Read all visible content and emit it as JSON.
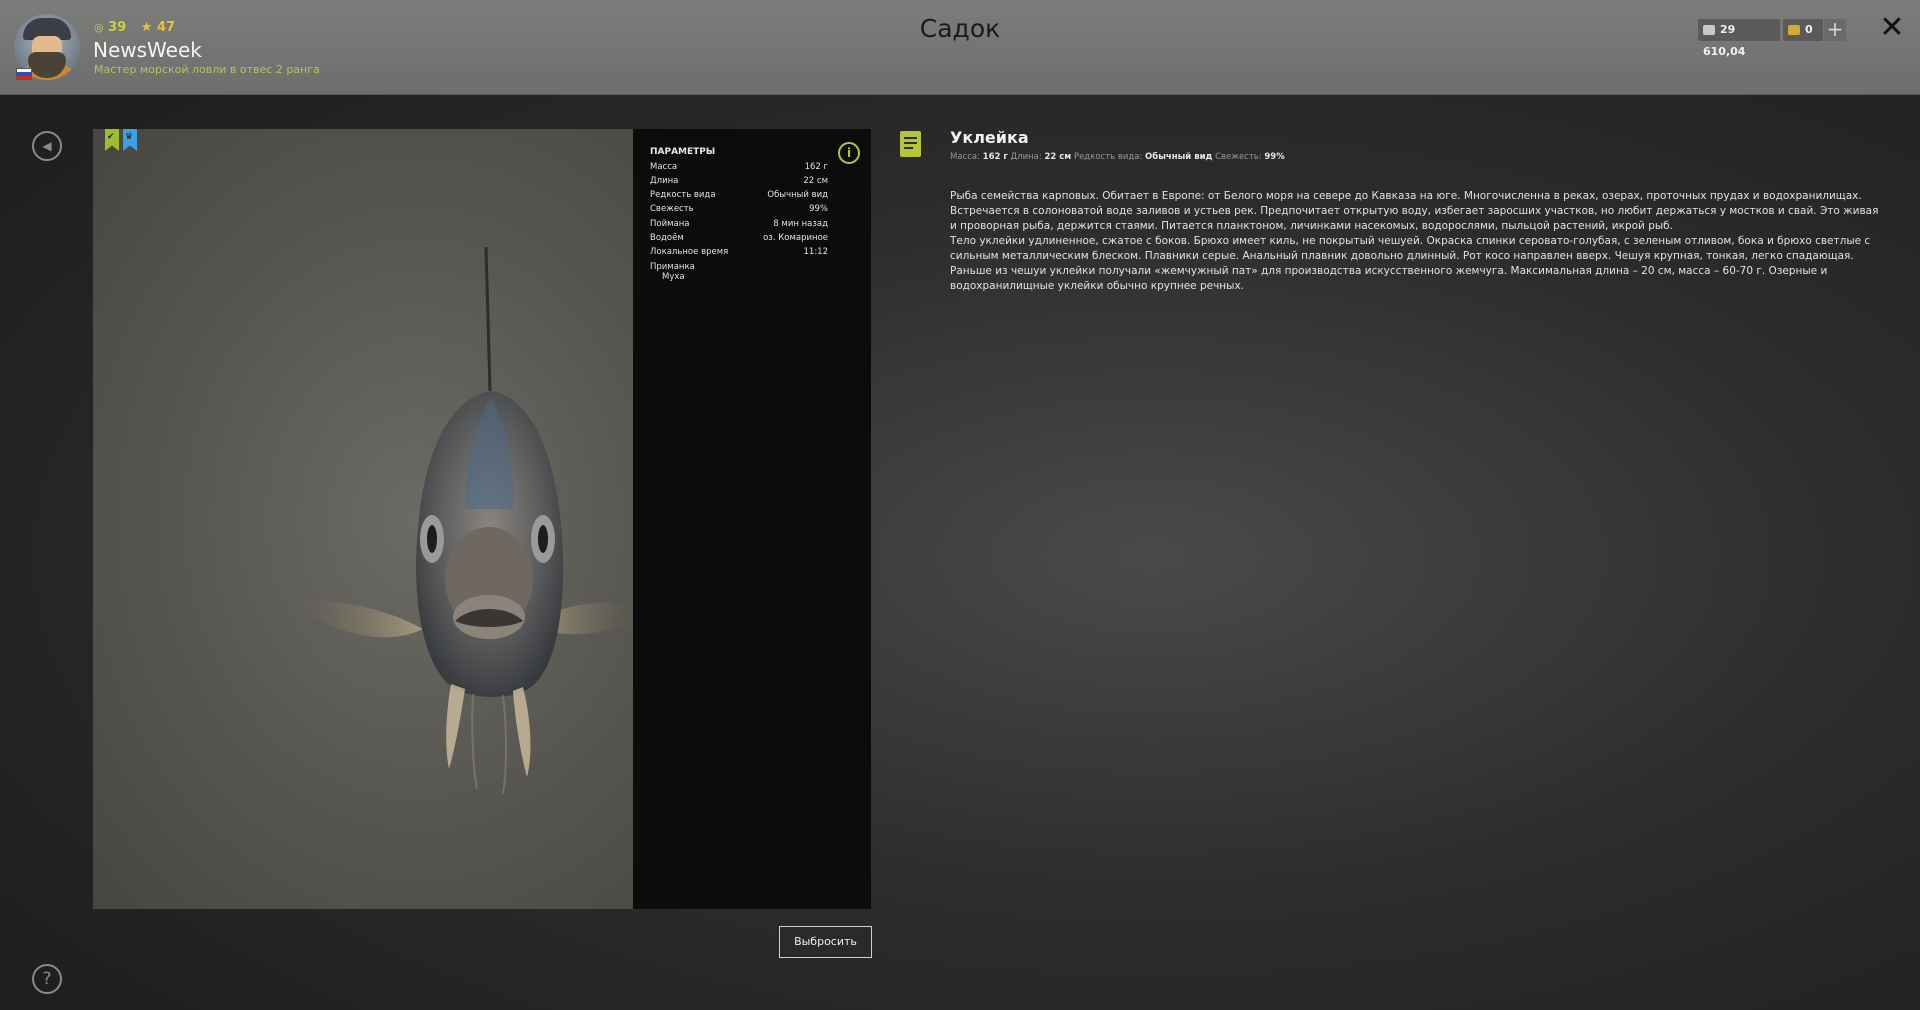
{
  "header": {
    "title": "Садок",
    "player": {
      "name": "NewsWeek",
      "level": "39",
      "stars": "47",
      "rank": "Мастер морской ловли в отвес 2 ранга"
    },
    "currency": {
      "silver": "29 610,04",
      "gold": "0"
    }
  },
  "fish": {
    "name": "Уклейка",
    "summary": {
      "mass_label": "Масса:",
      "mass": "162 г",
      "length_label": "Длина:",
      "length": "22 см",
      "rarity_label": "Редкость вида:",
      "rarity": "Обычный вид",
      "freshness_label": "Свежесть:",
      "freshness": "99%"
    },
    "description": [
      "Рыба семейства карповых. Обитает в Европе: от Белого моря на севере до Кавказа на юге. Многочисленна в реках, озерах, проточных прудах и водохранилищах. Встречается в солоноватой воде заливов и устьев рек. Предпочитает открытую воду, избегает заросших участков, но любит держаться у мостков и свай. Это живая и проворная рыба, держится стаями. Питается планктоном, личинками насекомых, водорослями, пыльцой растений, икрой рыб.",
      "Тело уклейки удлиненное, сжатое с боков. Брюхо имеет киль, не покрытый чешуей. Окраска спинки серовато-голубая, с зеленым отливом, бока и брюхо светлые с сильным металлическим блеском. Плавники серые. Анальный плавник довольно длинный. Рот косо направлен вверх. Чешуя крупная, тонкая, легко спадающая. Раньше из чешуи уклейки получали «жемчужный пат» для производства искусственного жемчуга. Максимальная длина – 20 см, масса – 60-70 г. Озерные и водохранилищные уклейки обычно крупнее речных."
    ]
  },
  "params": {
    "title": "ПАРАМЕТРЫ",
    "rows": [
      {
        "label": "Масса",
        "value": "162 г"
      },
      {
        "label": "Длина",
        "value": "22 см"
      },
      {
        "label": "Редкость вида",
        "value": "Обычный вид"
      },
      {
        "label": "Свежесть",
        "value": "99%"
      },
      {
        "label": "Поймана",
        "value": "8 мин назад"
      },
      {
        "label": "Водоём",
        "value": "оз. Комариное"
      },
      {
        "label": "Локальное время",
        "value": "11:12"
      }
    ],
    "bait_label": "Приманка",
    "bait_value": "Муха"
  },
  "buttons": {
    "discard": "Выбросить"
  },
  "icons": {
    "back": "back-icon",
    "help": "help-icon",
    "close": "close-icon",
    "info": "info-icon",
    "note": "note-icon",
    "silver": "silver-coin-icon",
    "gold": "gold-coin-icon"
  },
  "colors": {
    "accent": "#b5c53a",
    "bookmark_blue": "#3ca0e4",
    "bookmark_green": "#9cbf2e"
  }
}
